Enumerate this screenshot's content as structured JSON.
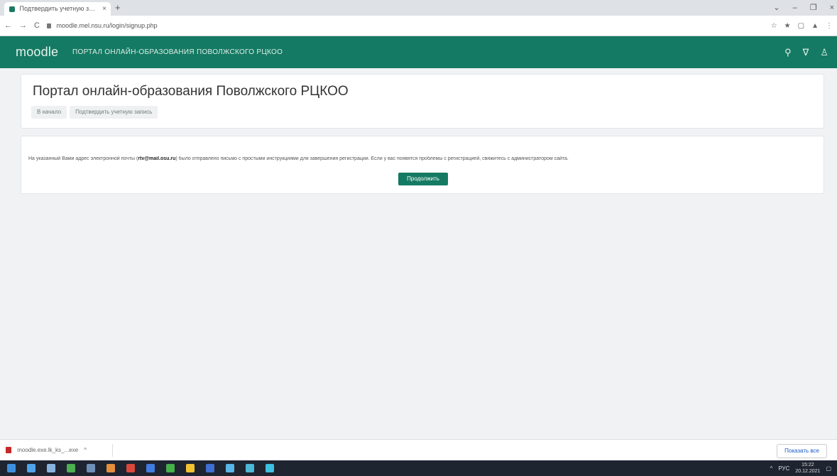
{
  "browser": {
    "tab_title": "Подтвердить учетную запись",
    "tab_close": "×",
    "new_tab": "+",
    "url": "moodle.mel.nsu.ru/login/signup.php",
    "window_controls": [
      "⌄",
      "–",
      "❐",
      "×"
    ],
    "nav_icons": [
      "←",
      "→",
      "C"
    ],
    "ext_icons": [
      "☆",
      "★",
      "▢",
      "▲",
      "⋮"
    ]
  },
  "header": {
    "logo_text": "moodle",
    "site_title": "ПОРТАЛ ОНЛАЙН-ОБРАЗОВАНИЯ ПОВОЛЖСКОГО РЦКОО",
    "icons": {
      "search": "⚲",
      "filter": "∇",
      "user": "♙"
    },
    "color": "#157a63"
  },
  "page": {
    "heading": "Портал онлайн-образования Поволжского РЦКОО",
    "breadcrumb": [
      "В начало",
      "Подтвердить учетную запись"
    ]
  },
  "notice": {
    "text_before": "На указанный Вами адрес электронной почты (",
    "email": "rtv@mail.osu.ru",
    "text_after": ") было отправлено письмо с простыми инструкциями для завершения регистрации. Если у вас появятся проблемы с регистрацией, свяжитесь с администратором сайта.",
    "continue_label": "Продолжить"
  },
  "downloads": {
    "file_name": "moodle.exe.lk_ks_...exe",
    "chevron": "^",
    "show_all": "Показать все"
  },
  "taskbar": {
    "time": "15:22",
    "date": "20.12.2021",
    "lang": "РУС",
    "icon_colors": [
      "#3d8fe0",
      "#4fa3ea",
      "#8ab4e0",
      "#4caf50",
      "#6e8fb8",
      "#e58f3d",
      "#d9483b",
      "#3f7de0",
      "#46b04a",
      "#f3c12f",
      "#3e6fd1",
      "#58b5e8",
      "#4bb8d6",
      "#3dbfe0"
    ]
  }
}
